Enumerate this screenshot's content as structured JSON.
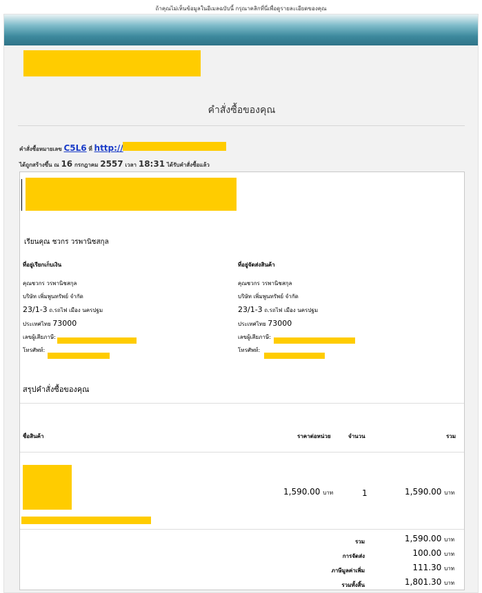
{
  "top_note": "ถ้าคุณไม่เห็นข้อมูลในอีเมลฉบับนี้ กรุณาคลิกที่นี่เพื่อดูรายละเอียดของคุณ",
  "page": {
    "heading": "คำสั่งซื้อของคุณ"
  },
  "order": {
    "number_prefix": "คำสั่งซื้อหมายเลข",
    "number": "C5L6",
    "at_label": "ที่",
    "url_visible": "http://",
    "created_prefix": "ได้ถูกสร้างขึ้น ณ",
    "day": "16",
    "month": "กรกฎาคม",
    "year": "2557",
    "time_label": "เวลา",
    "time": "18:31",
    "created_suffix": "ได้รับคำสั่งซื้อแล้ว"
  },
  "greeting": "เรียนคุณ ชวกร วรพานิชสกุล",
  "billing": {
    "label": "ที่อยู่เรียกเก็บเงิน",
    "name": "คุณชวกร วรพานิชสกุล",
    "company": "บริษัท เพิ่มพูนทรัพย์ จำกัด",
    "street_num": "23/1-3",
    "street": "ถ.รถไฟ เมือง นครปฐม",
    "country": "ประเทศไทย",
    "postcode": "73000",
    "tax_label": "เลขผู้เสียภาษี:",
    "phone_label": "โทรศัพท์:"
  },
  "shipping": {
    "label": "ที่อยู่จัดส่งสินค้า",
    "name": "คุณชวกร วรพานิชสกุล",
    "company": "บริษัท เพิ่มพูนทรัพย์ จำกัด",
    "street_num": "23/1-3",
    "street": "ถ.รถไฟ เมือง นครปฐม",
    "country": "ประเทศไทย",
    "postcode": "73000",
    "tax_label": "เลขผู้เสียภาษี:",
    "phone_label": "โทรศัพท์:"
  },
  "summary_title": "สรุปคำสั่งซื้อของคุณ",
  "table": {
    "col_product": "ชื่อสินค้า",
    "col_unit_price": "ราคาต่อหน่วย",
    "col_qty": "จำนวน",
    "col_total": "รวม",
    "row": {
      "unit_price": "1,590.00",
      "qty": "1",
      "total": "1,590.00",
      "currency": "บาท"
    }
  },
  "totals": {
    "currency": "บาท",
    "rows": [
      {
        "label": "รวม",
        "value": "1,590.00"
      },
      {
        "label": "การจัดส่ง",
        "value": "100.00"
      },
      {
        "label": "ภาษีมูลค่าเพิ่ม",
        "value": "111.30"
      },
      {
        "label": "รวมทั้งสิ้น",
        "value": "1,801.30"
      }
    ]
  },
  "colors": {
    "redaction": "#ffcc00",
    "link": "#1a3cc8",
    "banner": "#3e8a9e"
  }
}
